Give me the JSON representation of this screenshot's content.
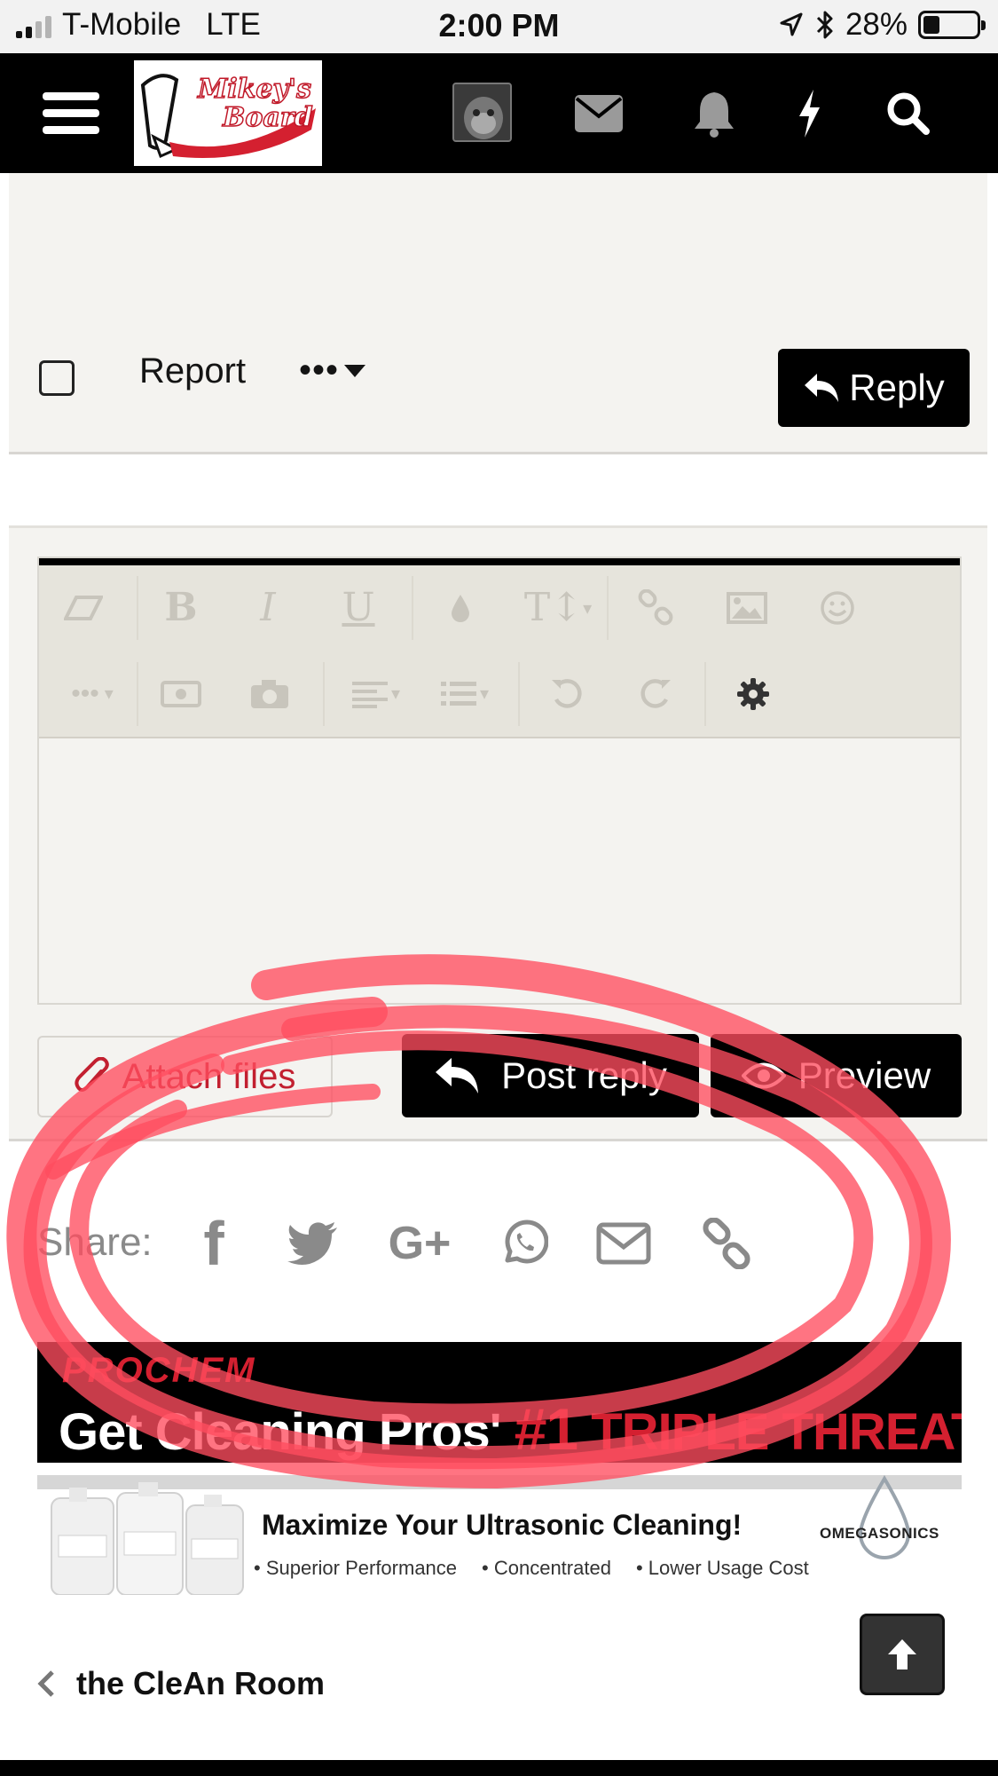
{
  "status_bar": {
    "carrier": "T-Mobile",
    "network": "LTE",
    "time": "2:00 PM",
    "battery": "28%"
  },
  "nav": {
    "logo_text_1": "Mikey's",
    "logo_text_2": "Board",
    "icons": [
      "menu-icon",
      "avatar",
      "envelope-icon",
      "bell-icon",
      "bolt-icon",
      "search-icon"
    ]
  },
  "post_actions": {
    "report_label": "Report",
    "more_label": "•••",
    "reply_label": "Reply"
  },
  "editor": {
    "toolbar_row1": [
      "eraser-icon",
      "bold-icon",
      "italic-icon",
      "underline-icon",
      "color-drop-icon",
      "font-size-icon",
      "link-icon",
      "image-icon",
      "smiley-icon"
    ],
    "toolbar_row2": [
      "more-icon",
      "media-icon",
      "camera-icon",
      "align-icon",
      "list-icon",
      "undo-icon",
      "redo-icon",
      "gear-icon"
    ],
    "bold_glyph": "B",
    "italic_glyph": "I",
    "underline_glyph": "U",
    "font_size_glyph": "T↕",
    "attach_label": "Attach files",
    "post_reply_label": "Post reply",
    "preview_label": "Preview"
  },
  "share": {
    "label": "Share:",
    "networks": [
      "facebook-icon",
      "twitter-icon",
      "google-plus-icon",
      "whatsapp-icon",
      "email-icon",
      "link-icon"
    ],
    "google_plus_text": "G+",
    "facebook_text": "f"
  },
  "ads": {
    "ad1_brand": "PROCHEM",
    "ad1_text_a": "Get Cleaning Pros' ",
    "ad1_text_b": "#1",
    "ad1_text_c": " TRIPLE THREAT",
    "ad2_title": "Maximize Your Ultrasonic Cleaning!",
    "ad2_bullets": [
      "• Superior Performance",
      "• Concentrated",
      "• Lower Usage Cost"
    ],
    "ad2_brand": "OMEGASONICS"
  },
  "footer": {
    "back_label": "the CleAn Room"
  },
  "colors": {
    "accent_red": "#d42030",
    "annotation_red": "#ff4d5f",
    "nav_black": "#000000",
    "panel_bg": "#f4f3f0"
  }
}
